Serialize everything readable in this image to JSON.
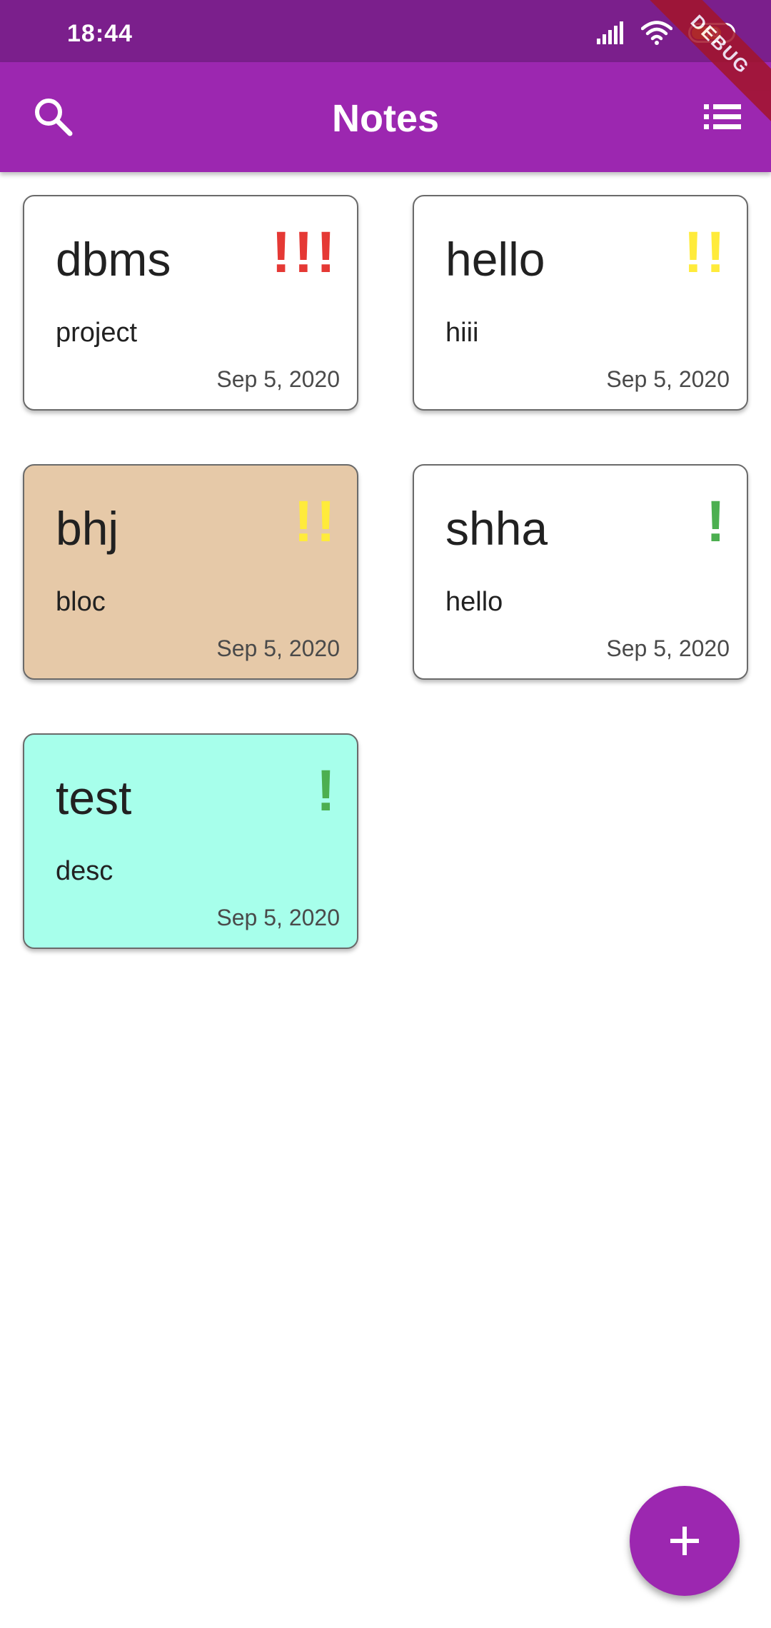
{
  "status_bar": {
    "time": "18:44",
    "battery": "70",
    "icons": [
      "signal-icon",
      "wifi-icon",
      "battery-icon"
    ]
  },
  "debug_banner": "DEBUG",
  "app_bar": {
    "title": "Notes",
    "leading_icon": "search-icon",
    "trailing_icon": "list-view-icon"
  },
  "notes": [
    {
      "title": "dbms",
      "description": "project",
      "date": "Sep 5, 2020",
      "priority": "!!!",
      "priority_color": "#e53935",
      "background": "#ffffff"
    },
    {
      "title": "hello",
      "description": "hiii",
      "date": "Sep 5, 2020",
      "priority": "!!",
      "priority_color": "#ffeb3b",
      "background": "#ffffff"
    },
    {
      "title": "bhj",
      "description": "bloc",
      "date": "Sep 5, 2020",
      "priority": "!!",
      "priority_color": "#ffeb3b",
      "background": "#e6c9a8"
    },
    {
      "title": "shha",
      "description": "hello",
      "date": "Sep 5, 2020",
      "priority": "!",
      "priority_color": "#4caf50",
      "background": "#ffffff"
    },
    {
      "title": "test",
      "description": "desc",
      "date": "Sep 5, 2020",
      "priority": "!",
      "priority_color": "#4caf50",
      "background": "#a7ffeb"
    }
  ],
  "fab": {
    "icon": "add-icon",
    "color": "#9c27b0"
  },
  "colors": {
    "status_bar": "#7b1f8c",
    "app_bar": "#9c27b0"
  }
}
